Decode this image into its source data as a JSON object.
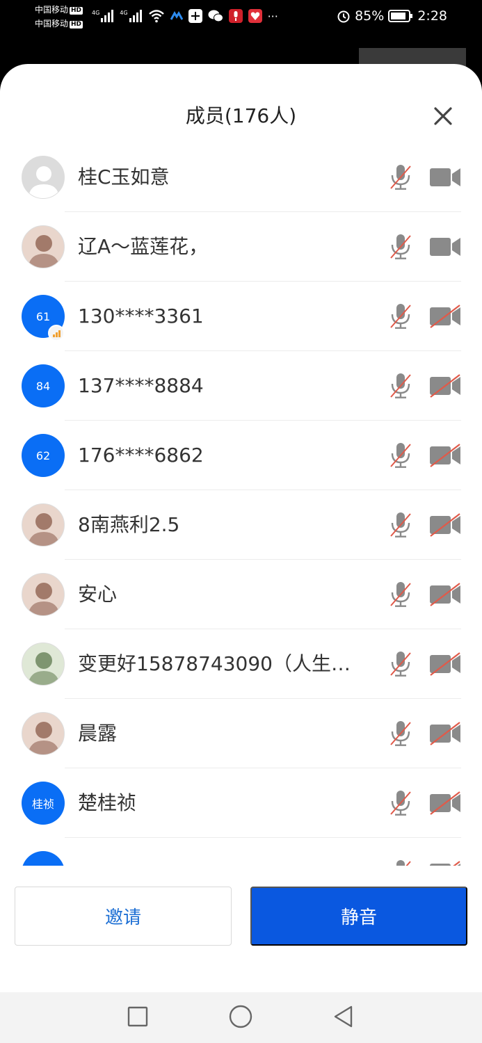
{
  "status_bar": {
    "carrier_1": "中国移动",
    "carrier_2": "中国移动",
    "hd_badge": "HD",
    "network": "4G",
    "more": "···",
    "battery": "85%",
    "time": "2:28",
    "icons": [
      "signal-icon",
      "signal-icon",
      "wifi-icon",
      "app-icon",
      "add-icon",
      "wechat-icon",
      "microphone-icon",
      "gift-icon",
      "alarm-icon",
      "battery-icon"
    ]
  },
  "sheet": {
    "title": "成员(176人)",
    "close_icon": "close-icon"
  },
  "members": [
    {
      "name": "桂C玉如意",
      "avatar_type": "default",
      "avatar_text": "",
      "mic_muted": true,
      "camera_off": false
    },
    {
      "name": "辽A～蓝莲花，",
      "avatar_type": "photo",
      "avatar_text": "",
      "mic_muted": true,
      "camera_off": false
    },
    {
      "name": "130****3361",
      "avatar_type": "blue",
      "avatar_text": "61",
      "mic_muted": true,
      "camera_off": true,
      "signal_badge": true
    },
    {
      "name": "137****8884",
      "avatar_type": "blue",
      "avatar_text": "84",
      "mic_muted": true,
      "camera_off": true
    },
    {
      "name": "176****6862",
      "avatar_type": "blue",
      "avatar_text": "62",
      "mic_muted": true,
      "camera_off": true
    },
    {
      "name": "8南燕利2.5",
      "avatar_type": "photo",
      "avatar_text": "",
      "mic_muted": true,
      "camera_off": true
    },
    {
      "name": "安心",
      "avatar_type": "photo",
      "avatar_text": "",
      "mic_muted": true,
      "camera_off": true
    },
    {
      "name": "变更好15878743090（人生…",
      "avatar_type": "photo",
      "avatar_text": "",
      "mic_muted": true,
      "camera_off": true
    },
    {
      "name": "晨露",
      "avatar_type": "photo",
      "avatar_text": "",
      "mic_muted": true,
      "camera_off": true
    },
    {
      "name": "楚桂祯",
      "avatar_type": "blue",
      "avatar_text": "桂祯",
      "mic_muted": true,
      "camera_off": true
    },
    {
      "name": "",
      "avatar_type": "blue",
      "avatar_text": "",
      "mic_muted": true,
      "camera_off": true
    }
  ],
  "buttons": {
    "invite": "邀请",
    "mute": "静音"
  },
  "colors": {
    "accent": "#0a58e0",
    "avatar_blue": "#0a6ef5",
    "muted_slash": "#e05a4a",
    "icon_gray": "#8a8a8a"
  },
  "nav_bar": [
    "square-icon",
    "circle-icon",
    "back-triangle-icon"
  ]
}
